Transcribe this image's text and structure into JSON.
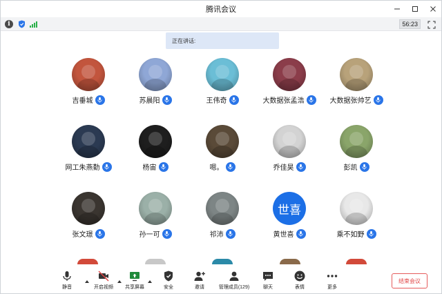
{
  "window": {
    "title": "腾讯会议"
  },
  "infobar": {
    "timer": "56:23"
  },
  "speaking": {
    "label": "正在讲话:"
  },
  "participants": [
    {
      "name": "吉垂城",
      "avatar": "avatar-a",
      "color": "#c2553d"
    },
    {
      "name": "苏晨阳",
      "avatar": "avatar-b",
      "color": "#8fa7d6"
    },
    {
      "name": "王伟奇",
      "avatar": "avatar-c",
      "color": "#6bbed6"
    },
    {
      "name": "大数据张孟浩",
      "avatar": "avatar-d",
      "color": "#8b3d4a"
    },
    {
      "name": "大数据张帅艺",
      "avatar": "avatar-e",
      "color": "#b8a27a"
    },
    {
      "name": "网工朱燕勤",
      "avatar": "avatar-f",
      "color": "#2b3a52"
    },
    {
      "name": "杨宙",
      "avatar": "avatar-g",
      "color": "#1e1e1e"
    },
    {
      "name": "嗯。",
      "avatar": "avatar-h",
      "color": "#5a4a38"
    },
    {
      "name": "乔佳昊",
      "avatar": "avatar-i",
      "color": "#d3d3d3"
    },
    {
      "name": "彭凯",
      "avatar": "avatar-j",
      "color": "#8aa56a"
    },
    {
      "name": "张文璟",
      "avatar": "avatar-k",
      "color": "#3a3530"
    },
    {
      "name": "孙一可",
      "avatar": "avatar-l",
      "color": "#9bb0a8"
    },
    {
      "name": "祁沛",
      "avatar": "avatar-m",
      "color": "#7d8585"
    },
    {
      "name": "黄世喜",
      "avatar": "avatar-n",
      "color": "#1c6fe6",
      "text": "世喜"
    },
    {
      "name": "乘不如野",
      "avatar": "avatar-o",
      "color": "#e8e8e8"
    }
  ],
  "toolbar": {
    "mute": "静音",
    "video": "开启视频",
    "share": "共享屏幕",
    "security": "安全",
    "invite": "邀请",
    "members": "管理成员(129)",
    "chat": "聊天",
    "reactions": "表情",
    "more": "更多",
    "end": "结束会议"
  },
  "colors": {
    "accent": "#2a75e8",
    "end": "#e04545"
  }
}
